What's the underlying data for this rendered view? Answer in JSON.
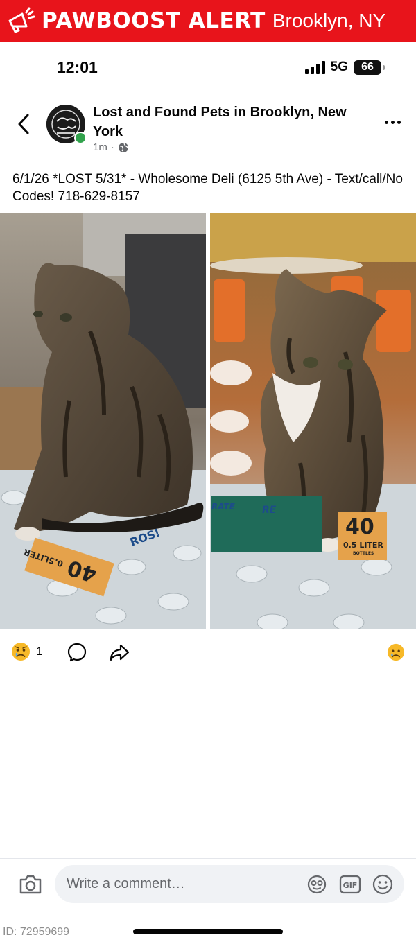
{
  "banner": {
    "title": "PAWBOOST ALERT",
    "location": "Brooklyn, NY",
    "bg_color": "#e8141b"
  },
  "status_bar": {
    "time": "12:01",
    "network": "5G",
    "battery": "66"
  },
  "post": {
    "group_name": "Lost and Found Pets in Brooklyn, New York",
    "timestamp": "1m",
    "privacy_icon": "globe-icon",
    "text": "6/1/26 *LOST 5/31* - Wholesome Deli (6125 5th Ave) - Text/call/No Codes!  718-629-8157",
    "reaction_count": "1"
  },
  "photo_text": {
    "left_bottle": "0.5LITER",
    "left_bottle_num": "40",
    "left_brand": "ROS!",
    "right_bottle_num": "40",
    "right_bottle": "0.5 LITER",
    "right_bottles": "BOTTLES",
    "right_brand": "RATE",
    "right_sub": "RE"
  },
  "composer": {
    "placeholder": "Write a comment…"
  },
  "footer": {
    "id": "ID: 72959699"
  }
}
